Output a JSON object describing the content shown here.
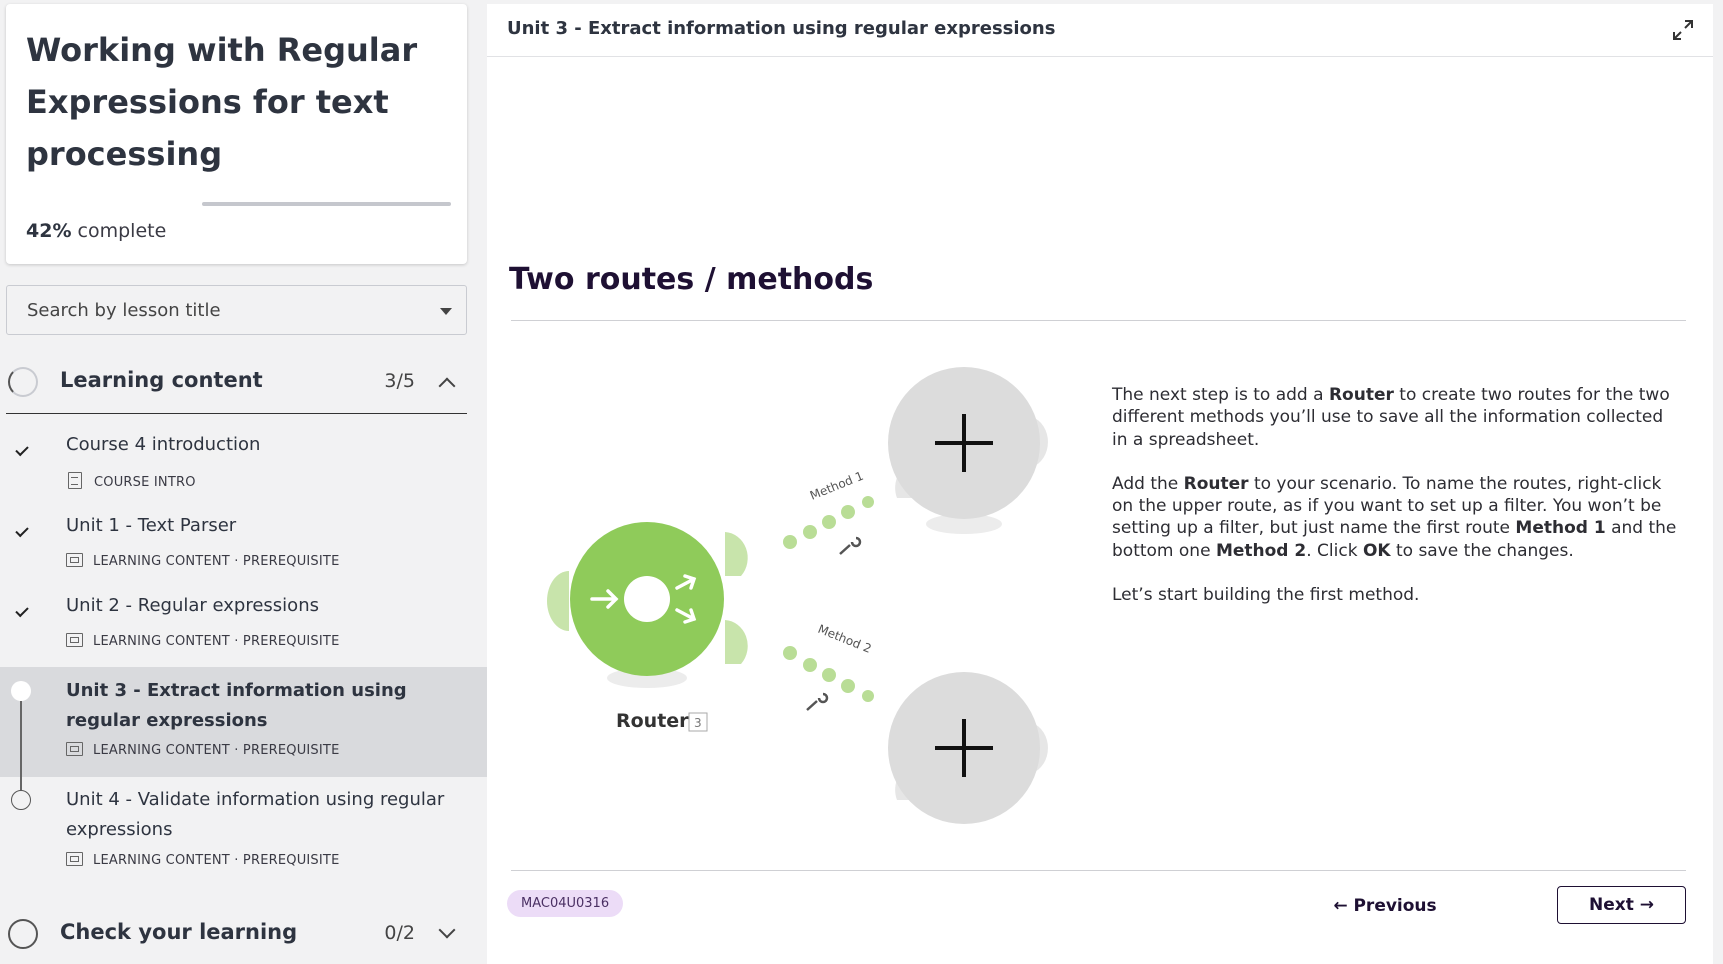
{
  "sidebar": {
    "course_title": "Working with Regular Expressions for text processing",
    "progress": {
      "percent": "42%",
      "label": "complete",
      "fraction": 0.42
    },
    "search": {
      "placeholder": "Search by lesson title"
    },
    "sections": [
      {
        "label": "Learning content",
        "count": "3/5",
        "lessons": [
          {
            "title": "Course 4 introduction",
            "meta": "COURSE INTRO",
            "status": "done"
          },
          {
            "title": "Unit 1 - Text Parser",
            "meta": "LEARNING CONTENT · PREREQUISITE",
            "status": "done"
          },
          {
            "title": "Unit 2 - Regular expressions",
            "meta": "LEARNING CONTENT · PREREQUISITE",
            "status": "done"
          },
          {
            "title": "Unit 3 - Extract information using regular expressions",
            "meta": "LEARNING CONTENT · PREREQUISITE",
            "status": "current"
          },
          {
            "title": "Unit 4 - Validate information using regular expressions",
            "meta": "LEARNING CONTENT · PREREQUISITE",
            "status": "todo"
          }
        ]
      },
      {
        "label": "Check your learning",
        "count": "0/2"
      }
    ]
  },
  "main": {
    "unit_title": "Unit 3 - Extract information using regular expressions",
    "heading": "Two routes / methods",
    "paragraphs": [
      [
        "The next step is to add a ",
        "Router",
        " to create two routes for the two different methods you’ll use to save all the information collected in a spreadsheet."
      ],
      [
        "Add the ",
        "Router",
        " to your scenario. To name the routes, right-click on the upper route, as if you want to set up a filter. You won’t be setting up a filter, but just name the first route ",
        "Method 1",
        " and the bottom one ",
        "Method 2",
        ". Click ",
        "OK",
        " to save the changes."
      ],
      [
        "Let’s start building the first method."
      ]
    ],
    "diagram": {
      "router_label": "Router",
      "router_badge": "3",
      "route1_label": "Method 1",
      "route2_label": "Method 2",
      "router_color": "#8fcb5a",
      "module_color": "#dcdcdc"
    },
    "code_badge": "MAC04U0316",
    "prev_label": "← Previous",
    "next_label": "Next →"
  }
}
